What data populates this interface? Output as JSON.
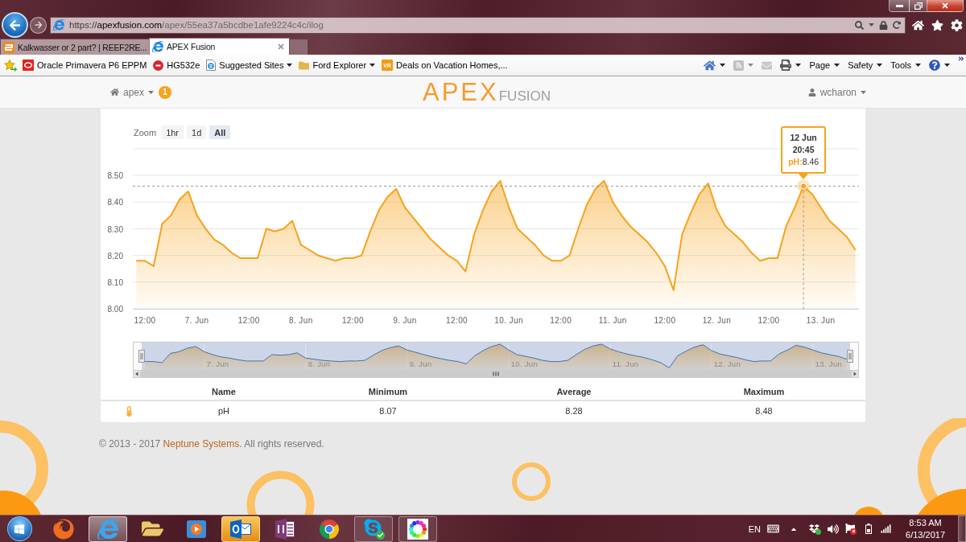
{
  "browser": {
    "address": {
      "scheme": "https://",
      "host": "apexfusion.com",
      "path": "/apex/55ea37a5bcdbe1afe9224c4c/ilog"
    },
    "tabs": [
      {
        "label": "Kalkwasser or 2 part? | REEF2RE...",
        "selected": false
      },
      {
        "label": "APEX Fusion",
        "selected": true
      }
    ],
    "favorites": [
      {
        "label": "Oracle Primavera P6 EPPM",
        "dropdown": false
      },
      {
        "label": "HG532e",
        "dropdown": false
      },
      {
        "label": "Suggested Sites",
        "dropdown": true
      },
      {
        "label": "Ford Explorer",
        "dropdown": true
      },
      {
        "label": "Deals on Vacation Homes,...",
        "dropdown": false,
        "icon_text": "VR"
      }
    ],
    "command_bar": [
      {
        "kind": "icon",
        "dropdown": true,
        "disabled": false
      },
      {
        "kind": "icon",
        "dropdown": true,
        "disabled": true
      },
      {
        "kind": "icon",
        "dropdown": false,
        "disabled": true
      },
      {
        "kind": "icon",
        "dropdown": true,
        "disabled": false
      },
      {
        "kind": "menu",
        "label": "Page",
        "dropdown": true,
        "disabled": false
      },
      {
        "kind": "menu",
        "label": "Safety",
        "dropdown": true,
        "disabled": false
      },
      {
        "kind": "menu",
        "label": "Tools",
        "dropdown": true,
        "disabled": false
      },
      {
        "kind": "icon",
        "dropdown": true,
        "disabled": false
      }
    ]
  },
  "header": {
    "home": "apex",
    "badge": "1",
    "logo": {
      "brand": "APEX",
      "product": "FUSION"
    },
    "user": "wcharon"
  },
  "chart_panel": {
    "zoom_label": "Zoom",
    "zoom_buttons": [
      {
        "label": "1hr",
        "selected": false
      },
      {
        "label": "1d",
        "selected": false
      },
      {
        "label": "All",
        "selected": true
      }
    ],
    "chart_data": {
      "type": "area",
      "grid": true,
      "categories": [
        null,
        "12:00",
        null,
        null,
        null,
        null,
        null,
        "7. Jun",
        null,
        null,
        null,
        null,
        null,
        "12:00",
        null,
        null,
        null,
        null,
        null,
        "8. Jun",
        null,
        null,
        null,
        null,
        null,
        "12:00",
        null,
        null,
        null,
        null,
        null,
        "9. Jun",
        null,
        null,
        null,
        null,
        null,
        "12:00",
        null,
        null,
        null,
        null,
        null,
        "10. Jun",
        null,
        null,
        null,
        null,
        null,
        "12:00",
        null,
        null,
        null,
        null,
        null,
        "11. Jun",
        null,
        null,
        null,
        null,
        null,
        "12:00",
        null,
        null,
        null,
        null,
        null,
        "12. Jun",
        null,
        null,
        null,
        null,
        null,
        "12:00",
        null,
        null,
        null,
        null,
        null,
        "13. Jun",
        null,
        null,
        null,
        null
      ],
      "series": [
        {
          "name": "pH",
          "color": "#f7a31b",
          "values": [
            8.18,
            8.18,
            8.16,
            8.32,
            8.35,
            8.41,
            8.44,
            8.35,
            8.3,
            8.26,
            8.24,
            8.21,
            8.19,
            8.19,
            8.19,
            8.3,
            8.29,
            8.3,
            8.33,
            8.24,
            8.22,
            8.2,
            8.19,
            8.18,
            8.19,
            8.19,
            8.2,
            8.29,
            8.37,
            8.42,
            8.45,
            8.38,
            8.34,
            8.3,
            8.26,
            8.23,
            8.2,
            8.18,
            8.14,
            8.28,
            8.37,
            8.44,
            8.48,
            8.38,
            8.3,
            8.27,
            8.24,
            8.2,
            8.18,
            8.18,
            8.2,
            8.3,
            8.39,
            8.45,
            8.48,
            8.4,
            8.35,
            8.31,
            8.28,
            8.25,
            8.21,
            8.16,
            8.07,
            8.28,
            8.36,
            8.43,
            8.47,
            8.37,
            8.31,
            8.28,
            8.25,
            8.21,
            8.18,
            8.19,
            8.19,
            8.31,
            8.38,
            8.46,
            8.43,
            8.38,
            8.33,
            8.3,
            8.27,
            8.22
          ]
        }
      ],
      "ylim": [
        8,
        8.6
      ],
      "yticks": [
        {
          "value": 8,
          "label": "8.00"
        },
        {
          "value": 8.1,
          "label": "8.10"
        },
        {
          "value": 8.2,
          "label": "8.20"
        },
        {
          "value": 8.3,
          "label": "8.30"
        },
        {
          "value": 8.4,
          "label": "8.40"
        },
        {
          "value": 8.5,
          "label": "8.50"
        }
      ],
      "ref_lines": [
        {
          "axis": "y",
          "value": 8.46
        }
      ],
      "annotations": [
        {
          "y": 8.46,
          "text": "8.46"
        }
      ]
    },
    "tooltip": {
      "date": "12 Jun",
      "time": "20:45",
      "separator": ":"
    },
    "navigator": {
      "labels": [
        "7. Jun",
        "8. Jun",
        "9. Jun",
        "10. Jun",
        "11. Jun",
        "12. Jun",
        "13. Jun"
      ]
    },
    "table": {
      "columns": [
        "Name",
        "Minimum",
        "Average",
        "Maximum"
      ],
      "rows": [
        {
          "cells": [
            "pH",
            "8.07",
            "8.28",
            "8.48"
          ]
        }
      ]
    }
  },
  "footer": {
    "prefix": "© 2013 - 2017",
    "link": "Neptune Systems",
    "suffix": ". All rights reserved."
  },
  "taskbar": {
    "apps": [
      {
        "running": false,
        "selected": false,
        "flashing": false
      },
      {
        "running": true,
        "selected": true,
        "flashing": false
      },
      {
        "running": false,
        "selected": false,
        "flashing": false
      },
      {
        "running": false,
        "selected": false,
        "flashing": false
      },
      {
        "running": true,
        "selected": false,
        "flashing": true
      },
      {
        "running": false,
        "selected": false,
        "flashing": false
      },
      {
        "running": false,
        "selected": false,
        "flashing": false
      },
      {
        "running": true,
        "selected": false,
        "flashing": false
      },
      {
        "running": true,
        "selected": false,
        "flashing": false
      }
    ],
    "tray": {
      "language": "EN",
      "time": "8:53 AM",
      "date": "6/13/2017"
    }
  }
}
